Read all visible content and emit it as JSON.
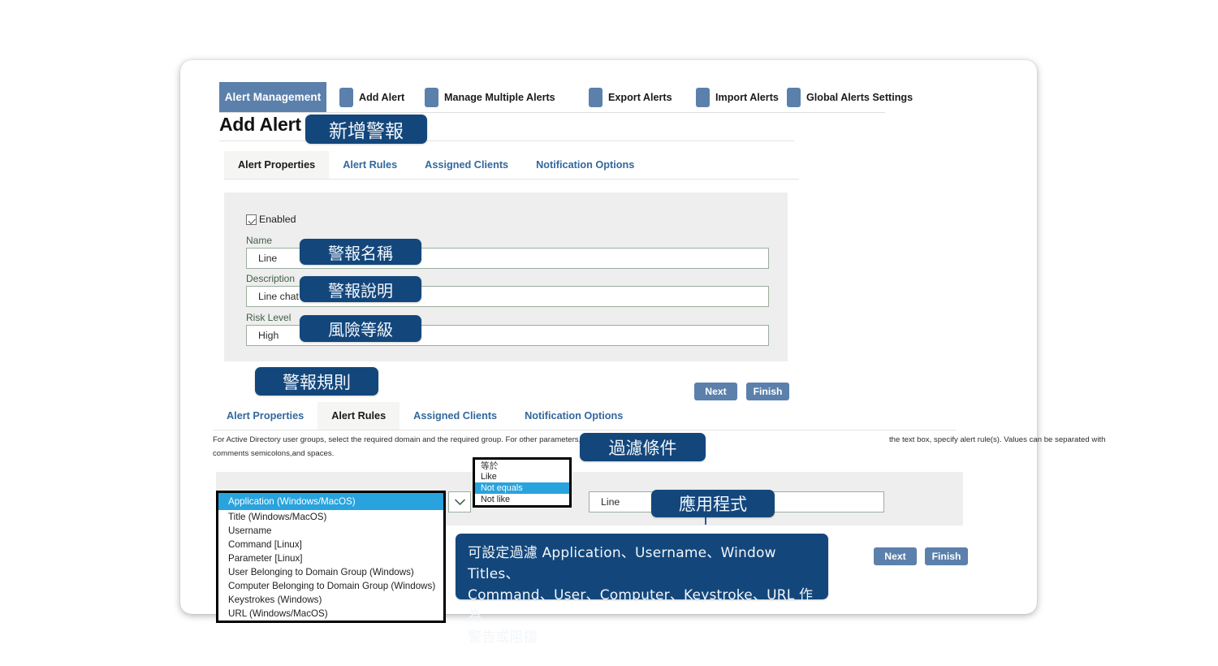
{
  "ribbon": {
    "active_label": "Alert Management",
    "items": [
      {
        "label": "Add Alert",
        "icon": "square-icon"
      },
      {
        "label": "Manage Multiple Alerts",
        "icon": "square-icon"
      },
      {
        "label": "Export Alerts",
        "icon": "square-icon"
      },
      {
        "label": "Import Alerts",
        "icon": "square-icon"
      },
      {
        "label": "Global Alerts Settings",
        "icon": "square-icon"
      }
    ]
  },
  "page": {
    "title": "Add Alert"
  },
  "tabs_top": [
    {
      "label": "Alert Properties",
      "active": true
    },
    {
      "label": "Alert Rules",
      "active": false
    },
    {
      "label": "Assigned Clients",
      "active": false
    },
    {
      "label": "Notification Options",
      "active": false
    }
  ],
  "tabs_bottom": [
    {
      "label": "Alert Properties",
      "active": false
    },
    {
      "label": "Alert Rules",
      "active": true
    },
    {
      "label": "Assigned Clients",
      "active": false
    },
    {
      "label": "Notification Options",
      "active": false
    }
  ],
  "properties": {
    "enabled_label": "Enabled",
    "enabled_checked": true,
    "name_label": "Name",
    "name_value": "Line",
    "description_label": "Description",
    "description_value": "Line chat",
    "risk_label": "Risk Level",
    "risk_value": "High"
  },
  "buttons": {
    "next": "Next",
    "finish": "Finish"
  },
  "rules": {
    "help_line1": "For Active Directory user groups, select the required domain and the required group. For other parameters,",
    "help_line2": "comments semicolons,and spaces.",
    "help_right": "the text box, specify alert rule(s). Values can be separated with",
    "parameter_selected": "Application (Windows/MacOS)",
    "parameter_options": [
      "Title (Windows/MacOS)",
      "Username",
      "Command [Linux]",
      "Parameter [Linux]",
      "User Belonging to Domain Group (Windows)",
      "Computer Belonging to Domain Group (Windows)",
      "Keystrokes (Windows)",
      "URL (Windows/MacOS)"
    ],
    "operator_options": [
      {
        "label": "等於",
        "selected": false,
        "zh": true
      },
      {
        "label": "Like",
        "selected": false,
        "zh": false
      },
      {
        "label": "Not equals",
        "selected": true,
        "zh": false
      },
      {
        "label": "Not like",
        "selected": false,
        "zh": false
      }
    ],
    "value": "Line",
    "dropdown_icon": "chevron-down-icon"
  },
  "annotations": {
    "add_alert": "新增警報",
    "alert_name": "警報名稱",
    "alert_description": "警報說明",
    "risk_level": "風險等級",
    "alert_rules": "警報規則",
    "filter_condition": "過濾條件",
    "application": "應用程式",
    "summary_line1": "可設定過濾 Application、Username、Window Titles、",
    "summary_line2": "Command、User、Computer、Keystroke、URL 作為",
    "summary_line3": "警告或阻擋"
  },
  "colors": {
    "ribbon_blue": "#5b80ab",
    "annotation_navy": "#13477c",
    "select_highlight": "#29a3dd",
    "panel_gray": "#eeeeee",
    "field_border_green": "#9cae9f",
    "label_green": "#3f5f45",
    "tab_link_blue": "#33689e"
  }
}
